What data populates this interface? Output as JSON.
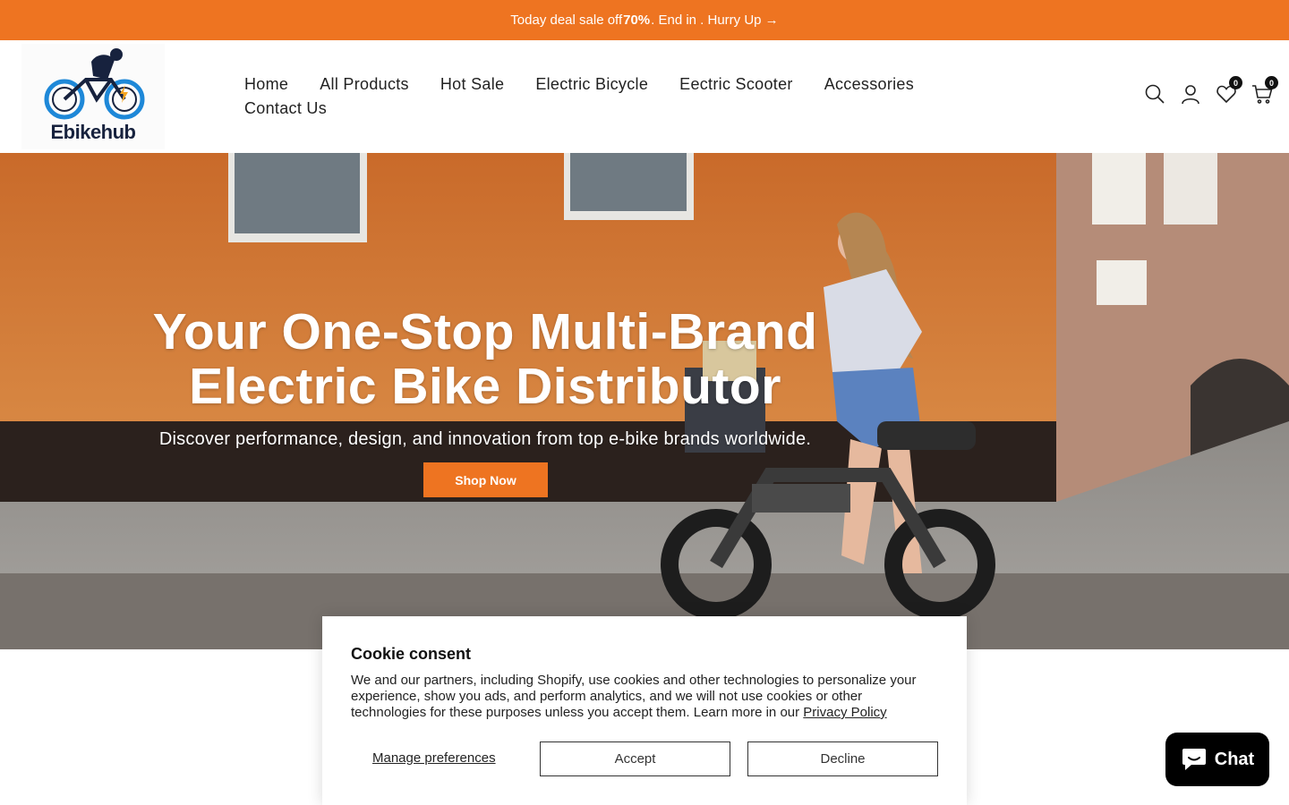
{
  "announcement": {
    "text_before": "Today deal sale off ",
    "highlight": "70%",
    "text_after": ". End in . Hurry Up →"
  },
  "header": {
    "logo_text": "Ebikehub",
    "nav": [
      "Home",
      "All Products",
      "Hot Sale",
      "Electric Bicycle",
      "Eectric Scooter",
      "Accessories",
      "Contact Us"
    ],
    "wishlist_count": "0",
    "cart_count": "0"
  },
  "hero": {
    "title_line1": "Your One-Stop Multi-Brand",
    "title_line2": "Electric Bike Distributor",
    "subtitle": "Discover performance, design, and innovation from top e-bike brands worldwide.",
    "button_label": "Shop Now"
  },
  "cookie": {
    "title": "Cookie consent",
    "body": "We and our partners, including Shopify, use cookies and other technologies to personalize your experience, show you ads, and perform analytics, and we will not use cookies or other technologies for these purposes unless you accept them. Learn more in our ",
    "policy_link": "Privacy Policy",
    "manage_label": "Manage preferences",
    "accept_label": "Accept",
    "decline_label": "Decline"
  },
  "chat": {
    "label": "Chat"
  },
  "colors": {
    "accent": "#ee7421"
  }
}
